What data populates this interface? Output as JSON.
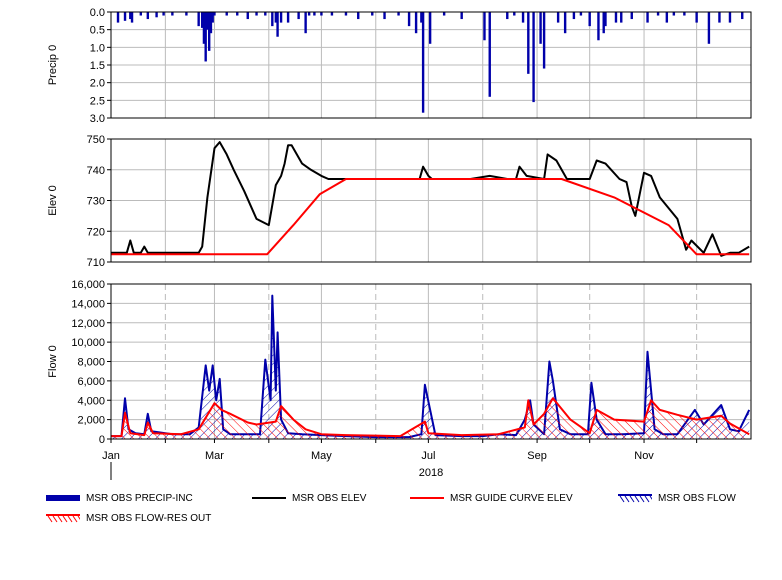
{
  "chart_data": [
    {
      "type": "bar",
      "ylabel": "Precip 0",
      "ylim": [
        0,
        3.0
      ],
      "y_inverted": true,
      "yticks": [
        "0.0",
        "0.5",
        "1.0",
        "1.5",
        "2.0",
        "2.5",
        "3.0"
      ],
      "grid": true,
      "series": [
        {
          "name": "MSR OBS PRECIP-INC",
          "color": "#0000aa",
          "x": [
            "2018-01-05",
            "2018-01-09",
            "2018-01-12",
            "2018-01-13",
            "2018-01-18",
            "2018-01-22",
            "2018-01-27",
            "2018-01-31",
            "2018-02-05",
            "2018-02-13",
            "2018-02-20",
            "2018-02-22",
            "2018-02-23",
            "2018-02-24",
            "2018-02-25",
            "2018-02-26",
            "2018-02-27",
            "2018-02-28",
            "2018-03-01",
            "2018-03-08",
            "2018-03-14",
            "2018-03-20",
            "2018-03-25",
            "2018-03-30",
            "2018-04-03",
            "2018-04-05",
            "2018-04-06",
            "2018-04-08",
            "2018-04-12",
            "2018-04-18",
            "2018-04-22",
            "2018-04-24",
            "2018-04-27",
            "2018-05-01",
            "2018-05-07",
            "2018-05-15",
            "2018-05-22",
            "2018-05-30",
            "2018-06-06",
            "2018-06-14",
            "2018-06-20",
            "2018-06-24",
            "2018-06-27",
            "2018-06-28",
            "2018-07-02",
            "2018-07-10",
            "2018-07-20",
            "2018-08-02",
            "2018-08-05",
            "2018-08-15",
            "2018-08-19",
            "2018-08-24",
            "2018-08-27",
            "2018-08-30",
            "2018-09-03",
            "2018-09-05",
            "2018-09-13",
            "2018-09-17",
            "2018-09-22",
            "2018-09-26",
            "2018-10-01",
            "2018-10-06",
            "2018-10-09",
            "2018-10-10",
            "2018-10-16",
            "2018-10-19",
            "2018-10-25",
            "2018-11-03",
            "2018-11-09",
            "2018-11-14",
            "2018-11-18",
            "2018-11-24",
            "2018-12-01",
            "2018-12-08",
            "2018-12-14",
            "2018-12-20",
            "2018-12-27"
          ],
          "values": [
            0.3,
            0.25,
            0.2,
            0.3,
            0.1,
            0.2,
            0.15,
            0.1,
            0.1,
            0.1,
            0.4,
            0.45,
            0.9,
            1.4,
            0.5,
            1.1,
            0.6,
            0.3,
            0.1,
            0.1,
            0.1,
            0.2,
            0.1,
            0.1,
            0.4,
            0.3,
            0.7,
            0.3,
            0.3,
            0.2,
            0.6,
            0.1,
            0.1,
            0.1,
            0.1,
            0.1,
            0.2,
            0.1,
            0.2,
            0.1,
            0.4,
            0.6,
            0.3,
            2.85,
            0.9,
            0.1,
            0.2,
            0.8,
            2.4,
            0.2,
            0.1,
            0.3,
            1.75,
            2.55,
            0.9,
            1.6,
            0.3,
            0.6,
            0.2,
            0.1,
            0.4,
            0.8,
            0.6,
            0.4,
            0.3,
            0.3,
            0.2,
            0.3,
            0.1,
            0.3,
            0.1,
            0.1,
            0.3,
            0.9,
            0.3,
            0.3,
            0.2
          ]
        }
      ]
    },
    {
      "type": "line",
      "ylabel": "Elev 0",
      "ylim": [
        710,
        750
      ],
      "yticks": [
        "710",
        "720",
        "730",
        "740",
        "750"
      ],
      "grid": true,
      "series": [
        {
          "name": "MSR OBS ELEV",
          "color": "#000000",
          "x": [
            "2018-01-01",
            "2018-01-08",
            "2018-01-10",
            "2018-01-12",
            "2018-01-14",
            "2018-01-18",
            "2018-01-20",
            "2018-01-22",
            "2018-02-05",
            "2018-02-15",
            "2018-02-20",
            "2018-02-22",
            "2018-02-25",
            "2018-03-01",
            "2018-03-04",
            "2018-03-08",
            "2018-03-12",
            "2018-03-18",
            "2018-03-25",
            "2018-04-01",
            "2018-04-05",
            "2018-04-08",
            "2018-04-10",
            "2018-04-12",
            "2018-04-14",
            "2018-04-20",
            "2018-04-25",
            "2018-05-01",
            "2018-05-05",
            "2018-06-10",
            "2018-06-26",
            "2018-06-28",
            "2018-07-01",
            "2018-07-03",
            "2018-07-25",
            "2018-08-05",
            "2018-08-15",
            "2018-08-20",
            "2018-08-22",
            "2018-08-26",
            "2018-09-05",
            "2018-09-07",
            "2018-09-12",
            "2018-09-18",
            "2018-10-01",
            "2018-10-05",
            "2018-10-10",
            "2018-10-18",
            "2018-10-22",
            "2018-10-25",
            "2018-10-27",
            "2018-11-01",
            "2018-11-05",
            "2018-11-10",
            "2018-11-20",
            "2018-11-25",
            "2018-11-28",
            "2018-12-05",
            "2018-12-10",
            "2018-12-15",
            "2018-12-20",
            "2018-12-25",
            "2018-12-31"
          ],
          "values": [
            713,
            713,
            713,
            717,
            713,
            713,
            715,
            713,
            713,
            713,
            713,
            715,
            731,
            747,
            749,
            745,
            740,
            733,
            724,
            722,
            735,
            738,
            742,
            748,
            748,
            742,
            740,
            738,
            737,
            737,
            737,
            741,
            738,
            737,
            737,
            738,
            737,
            737,
            741,
            738,
            737,
            745,
            743,
            737,
            737,
            743,
            742,
            737,
            736,
            728,
            725,
            739,
            738,
            731,
            724,
            714,
            717,
            713,
            719,
            712,
            713,
            713,
            715
          ]
        },
        {
          "name": "MSR GUIDE CURVE ELEV",
          "color": "#ff0000",
          "x": [
            "2018-01-01",
            "2018-03-31",
            "2018-04-15",
            "2018-04-30",
            "2018-05-15",
            "2018-09-15",
            "2018-10-15",
            "2018-11-15",
            "2018-12-01",
            "2018-12-31"
          ],
          "values": [
            712.5,
            712.5,
            722,
            732,
            737,
            737,
            731,
            722,
            712.5,
            712.5
          ]
        }
      ]
    },
    {
      "type": "area",
      "ylabel": "Flow 0",
      "ylim": [
        0,
        16000
      ],
      "yticks": [
        "0",
        "2,000",
        "4,000",
        "6,000",
        "8,000",
        "10,000",
        "12,000",
        "14,000",
        "16,000"
      ],
      "grid": true,
      "series": [
        {
          "name": "MSR OBS FLOW",
          "color": "#0000aa",
          "x": [
            "2018-01-01",
            "2018-01-07",
            "2018-01-09",
            "2018-01-11",
            "2018-01-15",
            "2018-01-20",
            "2018-01-22",
            "2018-01-24",
            "2018-02-05",
            "2018-02-15",
            "2018-02-20",
            "2018-02-24",
            "2018-02-26",
            "2018-02-28",
            "2018-03-02",
            "2018-03-04",
            "2018-03-06",
            "2018-03-10",
            "2018-03-20",
            "2018-03-27",
            "2018-03-30",
            "2018-04-02",
            "2018-04-03",
            "2018-04-05",
            "2018-04-06",
            "2018-04-08",
            "2018-04-12",
            "2018-04-20",
            "2018-05-01",
            "2018-05-15",
            "2018-06-01",
            "2018-06-20",
            "2018-06-27",
            "2018-06-29",
            "2018-07-05",
            "2018-07-20",
            "2018-08-01",
            "2018-08-10",
            "2018-08-20",
            "2018-08-25",
            "2018-08-28",
            "2018-08-30",
            "2018-09-05",
            "2018-09-08",
            "2018-09-10",
            "2018-09-14",
            "2018-09-20",
            "2018-09-30",
            "2018-10-02",
            "2018-10-05",
            "2018-10-10",
            "2018-10-20",
            "2018-11-01",
            "2018-11-03",
            "2018-11-05",
            "2018-11-07",
            "2018-11-12",
            "2018-11-20",
            "2018-11-30",
            "2018-12-05",
            "2018-12-15",
            "2018-12-20",
            "2018-12-25",
            "2018-12-31"
          ],
          "values": [
            300,
            300,
            4200,
            1000,
            600,
            500,
            2600,
            800,
            500,
            500,
            1200,
            7600,
            5000,
            7600,
            4000,
            6200,
            1000,
            500,
            500,
            500,
            8200,
            4000,
            14800,
            5000,
            11000,
            2000,
            600,
            500,
            400,
            300,
            200,
            200,
            500,
            5600,
            400,
            300,
            300,
            500,
            400,
            2000,
            4000,
            1500,
            500,
            8000,
            6000,
            1000,
            500,
            500,
            5800,
            2000,
            500,
            500,
            600,
            9000,
            5000,
            1000,
            500,
            500,
            3000,
            1500,
            3500,
            1000,
            800,
            3000
          ]
        },
        {
          "name": "MSR OBS FLOW-RES OUT",
          "color": "#ff0000",
          "x": [
            "2018-01-01",
            "2018-01-07",
            "2018-01-09",
            "2018-01-12",
            "2018-01-20",
            "2018-01-22",
            "2018-01-25",
            "2018-02-10",
            "2018-02-20",
            "2018-03-01",
            "2018-03-05",
            "2018-03-10",
            "2018-03-20",
            "2018-03-25",
            "2018-04-05",
            "2018-04-08",
            "2018-04-15",
            "2018-04-22",
            "2018-05-01",
            "2018-05-15",
            "2018-06-15",
            "2018-06-29",
            "2018-07-01",
            "2018-07-20",
            "2018-08-10",
            "2018-08-25",
            "2018-08-27",
            "2018-08-30",
            "2018-09-05",
            "2018-09-10",
            "2018-09-20",
            "2018-10-01",
            "2018-10-05",
            "2018-10-15",
            "2018-11-01",
            "2018-11-05",
            "2018-11-10",
            "2018-11-20",
            "2018-12-01",
            "2018-12-15",
            "2018-12-20",
            "2018-12-31"
          ],
          "values": [
            300,
            300,
            2700,
            600,
            400,
            1700,
            600,
            500,
            1000,
            3700,
            3000,
            2600,
            1700,
            1500,
            1800,
            3400,
            2000,
            1000,
            500,
            400,
            300,
            1800,
            600,
            400,
            500,
            1200,
            4000,
            1500,
            2600,
            4200,
            2000,
            600,
            3000,
            2000,
            1800,
            4000,
            3000,
            2500,
            2000,
            2400,
            1600,
            500
          ]
        }
      ]
    }
  ],
  "xaxis": {
    "month_labels": [
      "Jan",
      "Mar",
      "May",
      "Jul",
      "Sep",
      "Nov"
    ],
    "year_label": "2018",
    "range": [
      "2018-01-01",
      "2019-01-01"
    ]
  },
  "legend": [
    {
      "name": "MSR OBS PRECIP-INC",
      "kind": "bar",
      "color": "#0000aa"
    },
    {
      "name": "MSR OBS ELEV",
      "kind": "line",
      "color": "#000000"
    },
    {
      "name": "MSR GUIDE CURVE ELEV",
      "kind": "line",
      "color": "#ff0000"
    },
    {
      "name": "MSR OBS FLOW",
      "kind": "hatch",
      "color": "#0000aa"
    },
    {
      "name": "MSR OBS FLOW-RES OUT",
      "kind": "hatch",
      "color": "#ff0000"
    }
  ]
}
